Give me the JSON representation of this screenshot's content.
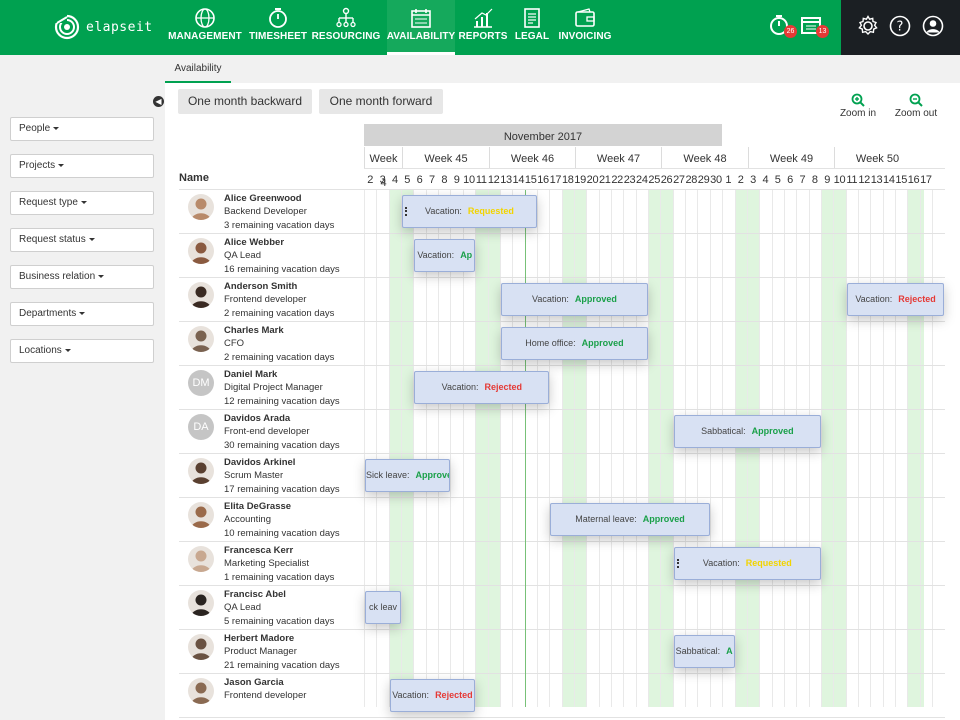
{
  "app": {
    "logo_text": "elapseit"
  },
  "nav": [
    {
      "label": "MANAGEMENT",
      "icon": "globe-icon"
    },
    {
      "label": "TIMESHEET",
      "icon": "stopwatch-icon"
    },
    {
      "label": "RESOURCING",
      "icon": "org-chart-icon"
    },
    {
      "label": "AVAILABILITY",
      "icon": "calendar-icon",
      "active": true
    },
    {
      "label": "REPORTS",
      "icon": "bar-chart-icon"
    },
    {
      "label": "LEGAL",
      "icon": "document-icon"
    },
    {
      "label": "INVOICING",
      "icon": "wallet-icon"
    }
  ],
  "notifications": {
    "timers": "26",
    "calendar": "13"
  },
  "system_icons": [
    "settings-icon",
    "help-icon",
    "user-icon"
  ],
  "subheader": {
    "tab": "Availability"
  },
  "filters": [
    "People",
    "Projects",
    "Request type",
    "Request status",
    "Business relation",
    "Departments",
    "Locations"
  ],
  "toolbar": {
    "backward": "One month backward",
    "forward": "One month forward",
    "zoom_in": "Zoom in",
    "zoom_out": "Zoom out"
  },
  "timeline": {
    "month": "November 2017",
    "name_header": "Name",
    "weeks": [
      "Week 4",
      "Week 45",
      "Week 46",
      "Week 47",
      "Week 48",
      "Week 49",
      "Week 50"
    ],
    "days": [
      "2",
      "3",
      "4",
      "5",
      "6",
      "7",
      "8",
      "9",
      "10",
      "11",
      "12",
      "13",
      "14",
      "15",
      "16",
      "17",
      "18",
      "19",
      "20",
      "21",
      "22",
      "23",
      "24",
      "25",
      "26",
      "27",
      "28",
      "29",
      "30",
      "1",
      "2",
      "3",
      "4",
      "5",
      "6",
      "7",
      "8",
      "9",
      "10",
      "11",
      "12",
      "13",
      "14",
      "15",
      "16",
      "17"
    ]
  },
  "people": [
    {
      "name": "Alice Greenwood",
      "role": "Backend Developer",
      "days": "3 remaining vacation days",
      "avatar": "photo",
      "tone": "#b88a6a"
    },
    {
      "name": "Alice Webber",
      "role": "QA Lead",
      "days": "16 remaining vacation days",
      "avatar": "photo",
      "tone": "#8a5a40"
    },
    {
      "name": "Anderson Smith",
      "role": "Frontend developer",
      "days": "2 remaining vacation days",
      "avatar": "photo",
      "tone": "#3a2a22"
    },
    {
      "name": "Charles Mark",
      "role": "CFO",
      "days": "2 remaining vacation days",
      "avatar": "photo",
      "tone": "#7a6250"
    },
    {
      "name": "Daniel Mark",
      "role": "Digital Project Manager",
      "days": "12 remaining vacation days",
      "avatar": "initials",
      "initials": "DM"
    },
    {
      "name": "Davidos Arada",
      "role": "Front-end developer",
      "days": "30 remaining vacation days",
      "avatar": "initials",
      "initials": "DA"
    },
    {
      "name": "Davidos Arkinel",
      "role": "Scrum Master",
      "days": "17 remaining vacation days",
      "avatar": "photo",
      "tone": "#5a4030"
    },
    {
      "name": "Elita DeGrasse",
      "role": "Accounting",
      "days": "10 remaining vacation days",
      "avatar": "photo",
      "tone": "#9a6a4a"
    },
    {
      "name": "Francesca Kerr",
      "role": "Marketing Specialist",
      "days": "1 remaining vacation days",
      "avatar": "photo",
      "tone": "#c8a890"
    },
    {
      "name": "Francisc Abel",
      "role": "QA Lead",
      "days": "5 remaining vacation days",
      "avatar": "photo",
      "tone": "#2a2420"
    },
    {
      "name": "Herbert Madore",
      "role": "Product Manager",
      "days": "21 remaining vacation days",
      "avatar": "photo",
      "tone": "#6a5242"
    },
    {
      "name": "Jason Garcia",
      "role": "Frontend developer",
      "days": "",
      "avatar": "photo",
      "tone": "#8a6a52"
    }
  ],
  "requests": [
    {
      "row": 0,
      "type": "Vacation:",
      "status": "Requested",
      "cls": "s-requested",
      "start": 3,
      "end": 13,
      "grip": true
    },
    {
      "row": 1,
      "type": "Vacation:",
      "status": "Ap",
      "cls": "s-approved",
      "start": 4,
      "end": 8
    },
    {
      "row": 2,
      "type": "Vacation:",
      "status": "Approved",
      "cls": "s-approved",
      "start": 11,
      "end": 22
    },
    {
      "row": 2,
      "type": "Vacation:",
      "status": "Rejected",
      "cls": "s-rejected",
      "start": 39,
      "end": 46
    },
    {
      "row": 3,
      "type": "Home office:",
      "status": "Approved",
      "cls": "s-approved",
      "start": 11,
      "end": 22
    },
    {
      "row": 4,
      "type": "Vacation:",
      "status": "Rejected",
      "cls": "s-rejected",
      "start": 4,
      "end": 14
    },
    {
      "row": 5,
      "type": "Sabbatical:",
      "status": "Approved",
      "cls": "s-approved",
      "start": 25,
      "end": 36
    },
    {
      "row": 6,
      "type": "Sick leave:",
      "status": "Approve",
      "cls": "s-approved",
      "start": 0,
      "end": 6
    },
    {
      "row": 7,
      "type": "Maternal leave:",
      "status": "Approved",
      "cls": "s-approved",
      "start": 15,
      "end": 27
    },
    {
      "row": 8,
      "type": "Vacation:",
      "status": "Requested",
      "cls": "s-requested",
      "start": 25,
      "end": 36,
      "grip": true
    },
    {
      "row": 9,
      "type": "ck leav",
      "status": "",
      "cls": "",
      "start": 0,
      "end": 2
    },
    {
      "row": 10,
      "type": "Sabbatical:",
      "status": "A",
      "cls": "s-approved",
      "start": 25,
      "end": 29
    },
    {
      "row": 11,
      "type": "Vacation:",
      "status": "Rejected",
      "cls": "s-rejected",
      "start": 2,
      "end": 8
    }
  ]
}
